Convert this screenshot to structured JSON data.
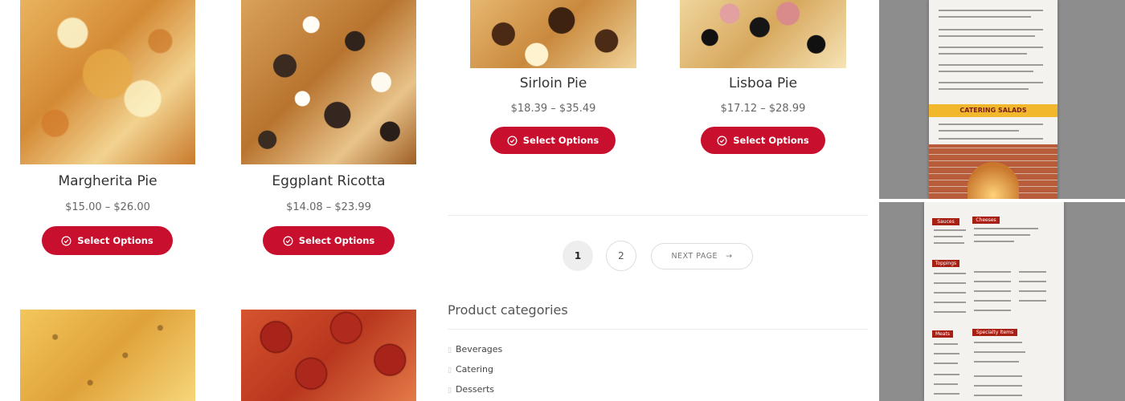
{
  "products": [
    {
      "name": "Margherita Pie",
      "price": "$15.00 – $26.00",
      "button": "Select Options"
    },
    {
      "name": "Eggplant Ricotta",
      "price": "$14.08 – $23.99",
      "button": "Select Options"
    },
    {
      "name": "Sirloin Pie",
      "price": "$18.39 – $35.49",
      "button": "Select Options"
    },
    {
      "name": "Lisboa Pie",
      "price": "$17.12 – $28.99",
      "button": "Select Options"
    }
  ],
  "pagination": {
    "pages": [
      "1",
      "2"
    ],
    "current": "1",
    "next_label": "NEXT PAGE",
    "next_arrow": "→"
  },
  "categories": {
    "title": "Product categories",
    "items": [
      "Beverages",
      "Catering",
      "Desserts"
    ]
  },
  "menu_photos": {
    "top_heading": "CATERING SALADS",
    "bottom_headings": [
      "Sauces",
      "Cheeses",
      "Toppings",
      "Meats",
      "Specialty Items"
    ]
  },
  "colors": {
    "accent": "#c8102e",
    "text": "#333333",
    "muted": "#666666"
  }
}
